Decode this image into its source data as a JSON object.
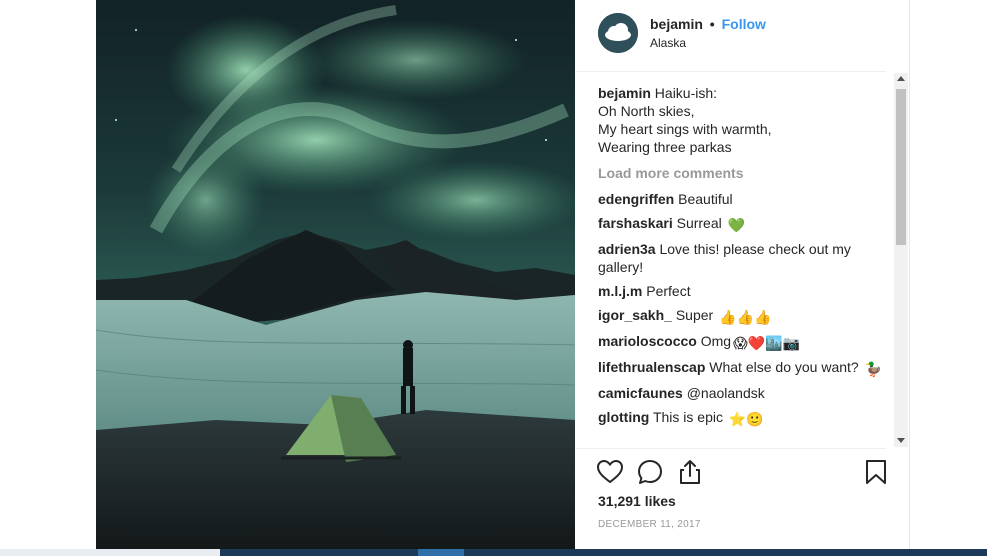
{
  "post": {
    "username": "bejamin",
    "separator": "•",
    "follow_label": "Follow",
    "location": "Alaska"
  },
  "caption": {
    "username": "bejamin",
    "lines": [
      "Haiku-ish:",
      "Oh North skies,",
      "My heart sings with warmth,",
      "Wearing three parkas"
    ]
  },
  "load_more_label": "Load more comments",
  "comments": [
    {
      "user": "edengriffen",
      "text": "Beautiful",
      "emoji": ""
    },
    {
      "user": "farshaskari",
      "text": "Surreal",
      "emoji": "💚"
    },
    {
      "user": "adrien3a",
      "text": "Love this! please check out my gallery!",
      "emoji": ""
    },
    {
      "user": "m.l.j.m",
      "text": "Perfect",
      "emoji": ""
    },
    {
      "user": "igor_sakh_",
      "text": "Super",
      "emoji": "👍👍👍"
    },
    {
      "user": "marioloscocco",
      "text": "Omg",
      "emoji": "😱❤️🏙️📷"
    },
    {
      "user": "lifethrualenscap",
      "text": "What else do you want?",
      "emoji": "🦆"
    },
    {
      "user": "camicfaunes",
      "text": "@naolandsk",
      "emoji": ""
    },
    {
      "user": "glotting",
      "text": "This is epic",
      "emoji": "⭐🙂"
    }
  ],
  "likes_text": "31,291 likes",
  "date_text": "DECEMBER 11, 2017",
  "colors": {
    "link": "#3897f0",
    "muted": "#999999",
    "text": "#262626"
  },
  "icons": [
    "heart-icon",
    "comment-icon",
    "share-icon",
    "bookmark-icon"
  ]
}
